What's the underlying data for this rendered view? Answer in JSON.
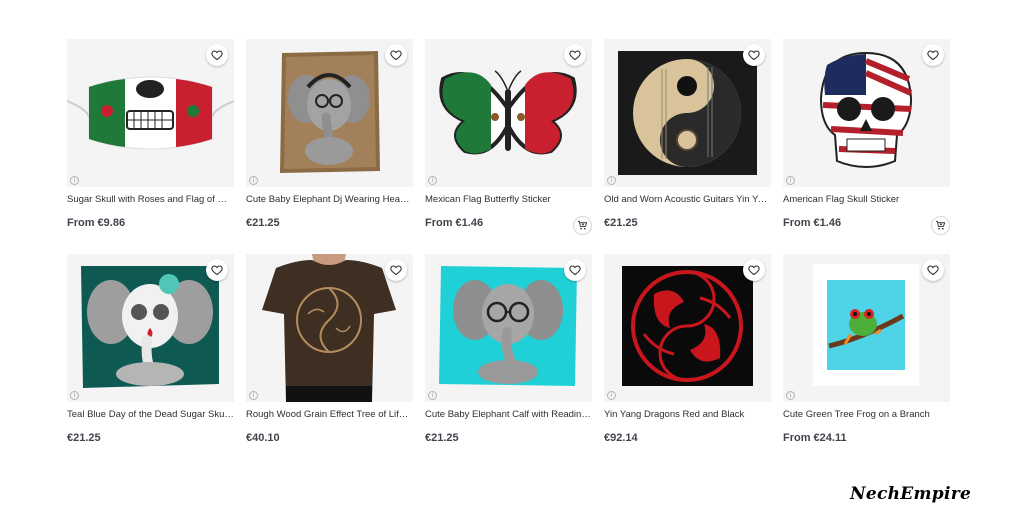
{
  "products": [
    {
      "title": "Sugar Skull with Roses and Flag of Mexico",
      "price": "From €9.86",
      "image": "sugar-skull-flag-mask",
      "has_cart": false
    },
    {
      "title": "Cute Baby Elephant Dj Wearing Headphones",
      "price": "€21.25",
      "image": "baby-elephant-headphones",
      "has_cart": false
    },
    {
      "title": "Mexican Flag Butterfly Sticker",
      "price": "From €1.46",
      "image": "mexican-flag-butterfly",
      "has_cart": true
    },
    {
      "title": "Old and Worn Acoustic Guitars Yin Yang",
      "price": "€21.25",
      "image": "acoustic-guitars-yin-yang",
      "has_cart": false
    },
    {
      "title": "American Flag Skull Sticker",
      "price": "From €1.46",
      "image": "american-flag-skull",
      "has_cart": true
    },
    {
      "title": "Teal Blue Day of the Dead Sugar Skull Baby Elephant",
      "price": "€21.25",
      "image": "sugar-skull-elephant",
      "has_cart": false
    },
    {
      "title": "Rough Wood Grain Effect Tree of Life Yin Yang",
      "price": "€40.10",
      "image": "tree-of-life-shirt",
      "has_cart": false
    },
    {
      "title": "Cute Baby Elephant Calf with Reading Glasses",
      "price": "€21.25",
      "image": "elephant-reading-glasses",
      "has_cart": false
    },
    {
      "title": "Yin Yang Dragons Red and Black",
      "price": "€92.14",
      "image": "yin-yang-dragons",
      "has_cart": false
    },
    {
      "title": "Cute Green Tree Frog on a Branch",
      "price": "From €24.11",
      "image": "tree-frog-branch",
      "has_cart": false
    }
  ],
  "info_glyph": "i",
  "watermark": "NechEmpire",
  "colors": {
    "thumb_bg": "#f2f2f2",
    "text": "#2c2f36",
    "price": "#40444c",
    "teal": "#1fd1d6",
    "mexico_green": "#1f7a3a",
    "mexico_red": "#c8202f"
  }
}
